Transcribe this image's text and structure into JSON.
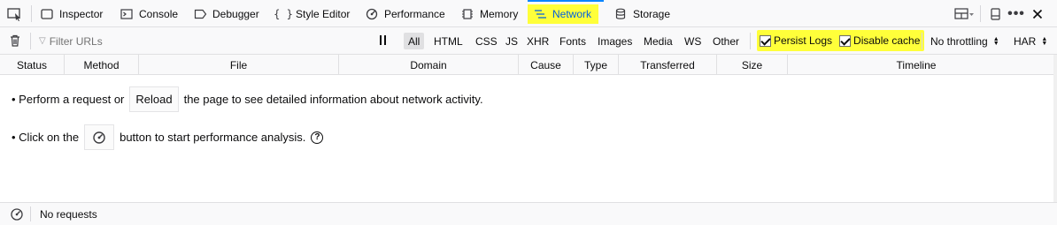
{
  "toolbar": {
    "tabs": [
      {
        "label": "Inspector",
        "icon": "inspector-icon"
      },
      {
        "label": "Console",
        "icon": "console-icon"
      },
      {
        "label": "Debugger",
        "icon": "debugger-icon"
      },
      {
        "label": "Style Editor",
        "icon": "style-editor-icon"
      },
      {
        "label": "Performance",
        "icon": "performance-icon"
      },
      {
        "label": "Memory",
        "icon": "memory-icon"
      },
      {
        "label": "Network",
        "icon": "network-icon",
        "selected": true
      },
      {
        "label": "Storage",
        "icon": "storage-icon"
      }
    ],
    "right_icons": [
      "layout-icon",
      "responsive-icon",
      "more-icon",
      "close-icon"
    ]
  },
  "filterbar": {
    "placeholder": "Filter URLs",
    "types": [
      "All",
      "HTML",
      "CSS",
      "JS",
      "XHR",
      "Fonts",
      "Images",
      "Media",
      "WS",
      "Other"
    ],
    "active_type": "All",
    "persist_logs": {
      "label": "Persist Logs",
      "checked": true
    },
    "disable_cache": {
      "label": "Disable cache",
      "checked": true
    },
    "throttling": "No throttling",
    "har": "HAR"
  },
  "columns": [
    "Status",
    "Method",
    "File",
    "Domain",
    "Cause",
    "Type",
    "Transferred",
    "Size",
    "Timeline"
  ],
  "empty": {
    "line1_before": "• Perform a request or",
    "reload_button": "Reload",
    "line1_after": "the page to see detailed information about network activity.",
    "line2_before": "• Click on the",
    "line2_after": "button to start performance analysis.",
    "help": "?"
  },
  "status": {
    "text": "No requests"
  },
  "colors": {
    "highlight": "#ffff3a",
    "accent": "#0a84ff",
    "selected_text": "#0060df"
  }
}
